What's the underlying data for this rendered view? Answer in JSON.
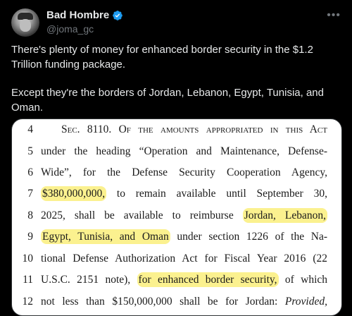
{
  "author": {
    "display_name": "Bad Hombre",
    "handle": "@joma_gc",
    "verified": true
  },
  "icons": {
    "more": "more-horizontal-icon",
    "verified": "verified-badge-icon"
  },
  "tweet": {
    "paragraph1": "There's plenty of money for enhanced border security in the $1.2 Trillion funding package.",
    "paragraph2": "Except they're the borders of Jordan, Lebanon, Egypt, Tunisia, and Oman."
  },
  "colors": {
    "background": "#000000",
    "text": "#e7e9ea",
    "muted": "#71767b",
    "verified": "#1d9bf0",
    "highlight": "#fbf18f"
  },
  "bill": {
    "lines": [
      {
        "no": "4",
        "parts": [
          {
            "t": "Sec. 8110. Of the amounts appropriated in this Act",
            "sc": true
          }
        ]
      },
      {
        "no": "5",
        "parts": [
          {
            "t": "under the heading “Operation and Maintenance, Defense-"
          }
        ]
      },
      {
        "no": "6",
        "parts": [
          {
            "t": "Wide”, for the Defense Security Cooperation Agency,"
          }
        ]
      },
      {
        "no": "7",
        "parts": [
          {
            "t": "$380,000,000,",
            "hl": true
          },
          {
            "t": " to remain available until September 30,"
          }
        ]
      },
      {
        "no": "8",
        "parts": [
          {
            "t": "2025, shall be available to reimburse "
          },
          {
            "t": "Jordan, Lebanon,",
            "hl": true
          }
        ]
      },
      {
        "no": "9",
        "parts": [
          {
            "t": "Egypt, Tunisia, and Oman",
            "hl": true
          },
          {
            "t": " under section 1226 of the Na-"
          }
        ]
      },
      {
        "no": "10",
        "parts": [
          {
            "t": "tional Defense Authorization Act for Fiscal Year 2016 (22"
          }
        ]
      },
      {
        "no": "11",
        "parts": [
          {
            "t": "U.S.C. 2151 note), "
          },
          {
            "t": "for enhanced border security,",
            "hl": true
          },
          {
            "t": " of which"
          }
        ]
      },
      {
        "no": "12",
        "parts": [
          {
            "t": "not less than $150,000,000 shall be for Jordan: "
          },
          {
            "t": "Provided,",
            "i": true
          }
        ]
      }
    ]
  }
}
